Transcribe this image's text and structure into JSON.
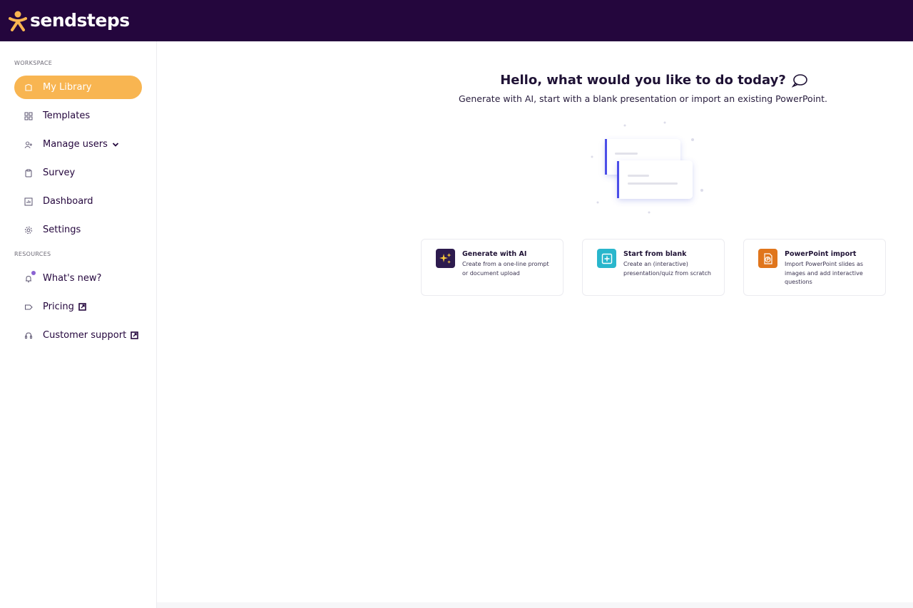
{
  "app": {
    "brand": "sendsteps",
    "brand_color": "#24063d",
    "accent_color": "#f8b551"
  },
  "sidebar": {
    "workspace_label": "WORKSPACE",
    "resources_label": "RESOURCES",
    "items": [
      {
        "label": "My Library",
        "icon": "library-icon",
        "active": true
      },
      {
        "label": "Templates",
        "icon": "templates-icon"
      },
      {
        "label": "Manage users",
        "icon": "add-user-icon"
      },
      {
        "label": "Survey",
        "icon": "clipboard-icon"
      },
      {
        "label": "Dashboard",
        "icon": "dashboard-icon"
      },
      {
        "label": "Settings",
        "icon": "gear-icon"
      }
    ],
    "resources": [
      {
        "label": "What's new?",
        "icon": "bell-icon"
      },
      {
        "label": "Pricing",
        "icon": "tag-icon"
      },
      {
        "label": "Customer support",
        "icon": "headset-icon"
      }
    ]
  },
  "main": {
    "headline": "Hello, what would you like to do today?",
    "subline": "Generate with AI, start with a blank presentation or import an existing PowerPoint.",
    "cards": [
      {
        "title": "Generate with AI",
        "description": "Create from a one-line prompt or document upload",
        "icon": "sparkles-icon",
        "color": "#2d1b4e"
      },
      {
        "title": "Start from blank",
        "description": "Create an (interactive) presentation/quiz from scratch",
        "icon": "plus-square-icon",
        "color": "#29b6cc"
      },
      {
        "title": "PowerPoint import",
        "description": "Import PowerPoint slides as images and add interactive questions",
        "icon": "powerpoint-icon",
        "color": "#e0751c"
      }
    ]
  }
}
